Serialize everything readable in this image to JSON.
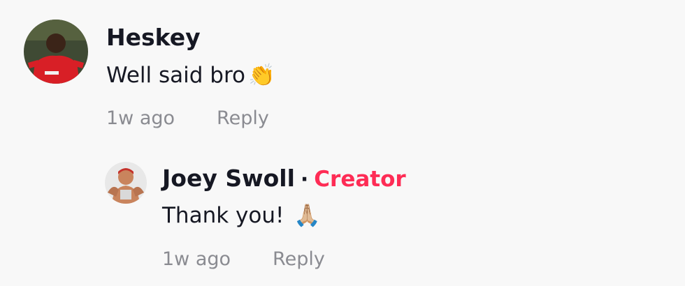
{
  "comments": [
    {
      "username": "Heskey",
      "text": "Well said bro",
      "emoji": "👏",
      "timestamp": "1w ago",
      "reply_label": "Reply",
      "avatar_icon": "user-avatar-red-jersey"
    }
  ],
  "reply": {
    "username": "Joey Swoll",
    "separator": "·",
    "badge": "Creator",
    "text": "Thank you! ",
    "emoji": "🙏🏼",
    "timestamp": "1w ago",
    "reply_label": "Reply",
    "avatar_icon": "user-avatar-cartoon",
    "badge_color": "#fe2c55"
  }
}
